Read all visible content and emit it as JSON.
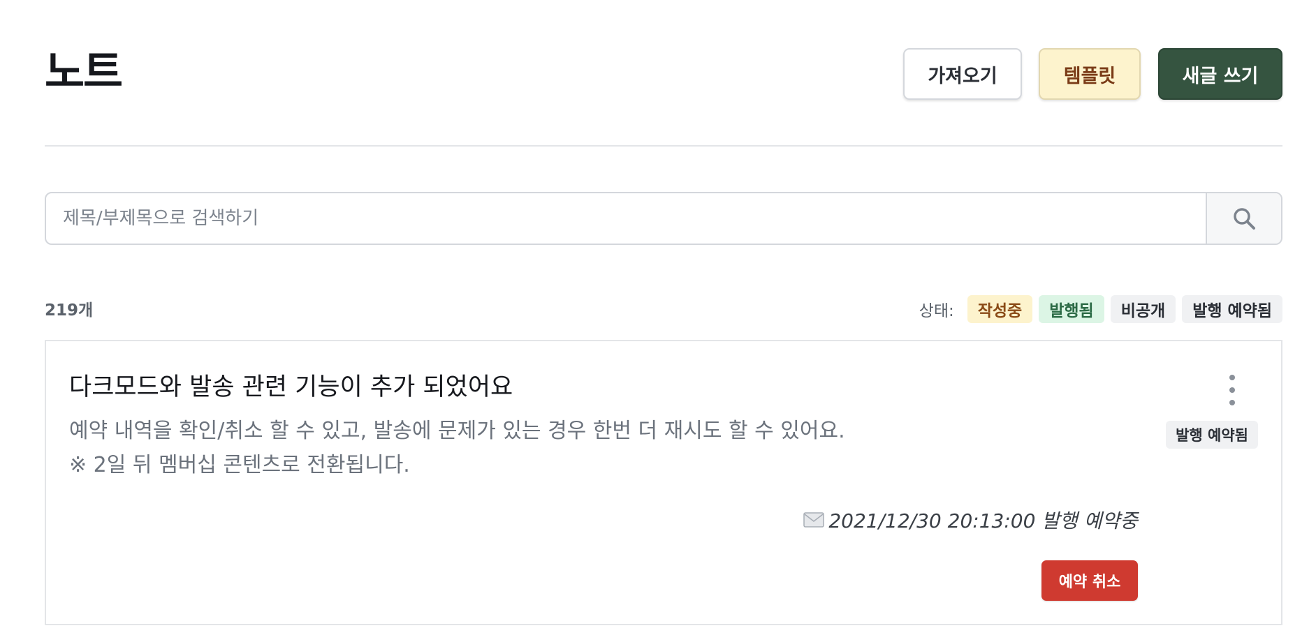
{
  "header": {
    "title": "노트",
    "import_label": "가져오기",
    "template_label": "템플릿",
    "new_label": "새글 쓰기"
  },
  "search": {
    "placeholder": "제목/부제목으로 검색하기",
    "icon": "search-icon"
  },
  "list": {
    "count": "219개",
    "status_label": "상태:",
    "filters": [
      {
        "label": "작성중",
        "color": "#fdf3cd"
      },
      {
        "label": "발행됨",
        "color": "#dcf5e5"
      },
      {
        "label": "비공개",
        "color": "#f0f1f3"
      },
      {
        "label": "발행 예약됨",
        "color": "#f0f1f3"
      }
    ]
  },
  "notes": [
    {
      "title": "다크모드와 발송 관련 기능이 추가 되었어요",
      "description_line1": "예약 내역을 확인/취소 할 수 있고, 발송에 문제가 있는 경우 한번 더 재시도 할 수 있어요.",
      "description_line2": "※ 2일 뒤 멤버십 콘텐츠로 전환됩니다.",
      "status_badge": "발행 예약됨",
      "schedule_text": "2021/12/30 20:13:00 발행 예약중",
      "schedule_icon": "envelope-icon",
      "cancel_label": "예약 취소",
      "menu_icon": "more-vertical-icon"
    }
  ],
  "colors": {
    "primary_dark_green": "#355440",
    "template_yellow": "#fdf3cd",
    "danger_red": "#cf3a30"
  }
}
